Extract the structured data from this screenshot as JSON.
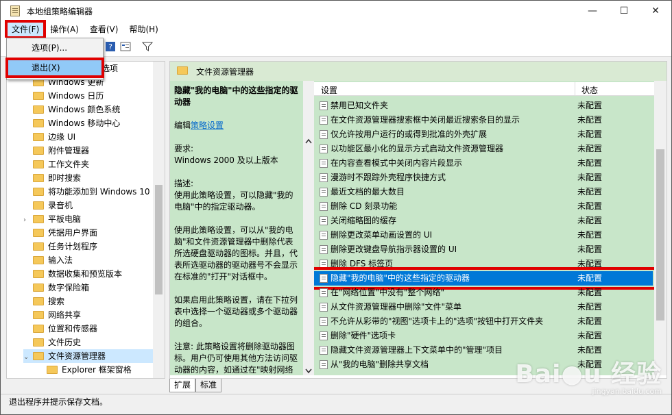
{
  "window": {
    "title": "本地组策略编辑器"
  },
  "menubar": {
    "file": "文件(F)",
    "action": "操作(A)",
    "view": "查看(V)",
    "help": "帮助(H)"
  },
  "file_menu": {
    "options": "选项(P)...",
    "exit": "退出(X)"
  },
  "tree": {
    "partial_top": "选项",
    "items": [
      "Windows 更新",
      "Windows 日历",
      "Windows 颜色系统",
      "Windows 移动中心",
      "边缘 UI",
      "附件管理器",
      "工作文件夹",
      "即时搜索",
      "将功能添加到 Windows 10",
      "录音机",
      "平板电脑",
      "凭据用户界面",
      "任务计划程序",
      "输入法",
      "数据收集和预览版本",
      "数字保险箱",
      "搜索",
      "网络共享",
      "位置和传感器",
      "文件历史",
      "文件资源管理器",
      "Explorer 框架窗格"
    ]
  },
  "right_header": {
    "title": "文件资源管理器"
  },
  "description": {
    "title": "隐藏\"我的电脑\"中的这些指定的驱动器",
    "edit_prefix": "编辑",
    "edit_link": "策略设置",
    "requirements_label": "要求:",
    "requirements": "Windows 2000 及以上版本",
    "desc_label": "描述:",
    "desc1": "使用此策略设置，可以隐藏\"我的电脑\"中的指定驱动器。",
    "desc2": "使用此策略设置，可以从\"我的电脑\"和文件资源管理器中删除代表所选硬盘驱动器的图标。并且，代表所选驱动器的驱动器号不会显示在标准的\"打开\"对话框中。",
    "desc3": "如果启用此策略设置，请在下拉列表中选择一个驱动器或多个驱动器的组合。",
    "desc4": "注意: 此策略设置将删除驱动器图标。用户仍可使用其他方法访问驱动器的内容，如通过在\"映射网络驱"
  },
  "list": {
    "col_name": "设置",
    "col_state": "状态",
    "rows": [
      {
        "name": "禁用已知文件夹",
        "state": "未配置"
      },
      {
        "name": "在文件资源管理器搜索框中关闭最近搜索条目的显示",
        "state": "未配置"
      },
      {
        "name": "仅允许按用户运行的或得到批准的外壳扩展",
        "state": "未配置"
      },
      {
        "name": "以功能区最小化的显示方式启动文件资源管理器",
        "state": "未配置"
      },
      {
        "name": "在内容查看模式中关闭内容片段显示",
        "state": "未配置"
      },
      {
        "name": "漫游时不跟踪外壳程序快捷方式",
        "state": "未配置"
      },
      {
        "name": "最近文档的最大数目",
        "state": "未配置"
      },
      {
        "name": "删除 CD 刻录功能",
        "state": "未配置"
      },
      {
        "name": "关闭缩略图的缓存",
        "state": "未配置"
      },
      {
        "name": "删除更改菜单动画设置的 UI",
        "state": "未配置"
      },
      {
        "name": "删除更改键盘导航指示器设置的 UI",
        "state": "未配置"
      },
      {
        "name": "删除 DFS 标签页",
        "state": "未配置"
      },
      {
        "name": "隐藏\"我的电脑\"中的这些指定的驱动器",
        "state": "未配置"
      },
      {
        "name": "在\"网络位置\"中没有\"整个网络\"",
        "state": "未配置"
      },
      {
        "name": "从文件资源管理器中删除\"文件\"菜单",
        "state": "未配置"
      },
      {
        "name": "不允许从彩带的\"视图\"选项卡上的\"选项\"按钮中打开文件夹",
        "state": "未配置"
      },
      {
        "name": "删除\"硬件\"选项卡",
        "state": "未配置"
      },
      {
        "name": "隐藏文件资源管理器上下文菜单中的\"管理\"项目",
        "state": "未配置"
      },
      {
        "name": "从\"我的电脑\"删除共享文档",
        "state": "未配置"
      }
    ]
  },
  "tabs": {
    "extended": "扩展",
    "standard": "标准"
  },
  "status": {
    "text": "退出程序并提示保存文档。"
  },
  "watermark": {
    "url": "jingyan.baidu.com"
  },
  "colors": {
    "highlight_red": "#e00000",
    "selection_blue": "#0078d7",
    "panel_green": "#c8e6c9"
  }
}
